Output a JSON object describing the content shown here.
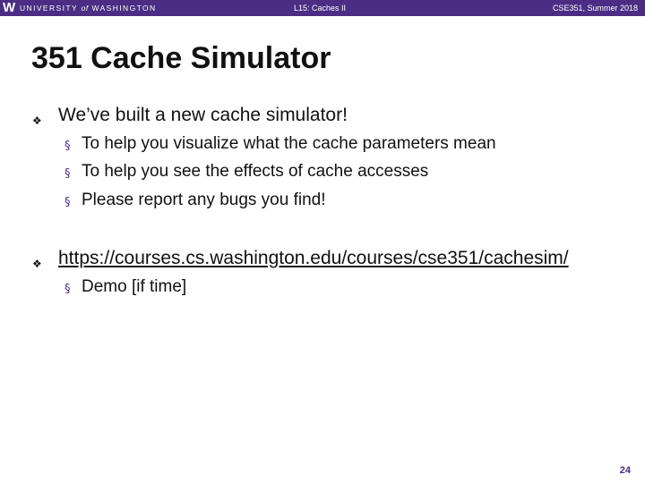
{
  "header": {
    "logo_mark": "W",
    "university_pre": "UNIVERSITY",
    "university_of": "of",
    "university_post": "WASHINGTON",
    "lecture": "L15: Caches II",
    "course": "CSE351, Summer 2018"
  },
  "slide": {
    "title": "351 Cache Simulator",
    "bullets": [
      {
        "marker": "❖",
        "text": "We’ve built a new cache simulator!",
        "sub": [
          {
            "marker": "§",
            "text": "To help you visualize what the cache parameters mean"
          },
          {
            "marker": "§",
            "text": "To help you see the effects of cache accesses"
          },
          {
            "marker": "§",
            "text": "Please report any bugs you find!"
          }
        ]
      },
      {
        "marker": "❖",
        "text": "https://courses.cs.washington.edu/courses/cse351/cachesim/",
        "sub": [
          {
            "marker": "§",
            "text": "Demo [if time]"
          }
        ]
      }
    ],
    "page_number": "24"
  },
  "colors": {
    "header_bg": "#4b2e83",
    "accent": "#4b2e83",
    "text": "#111111"
  }
}
